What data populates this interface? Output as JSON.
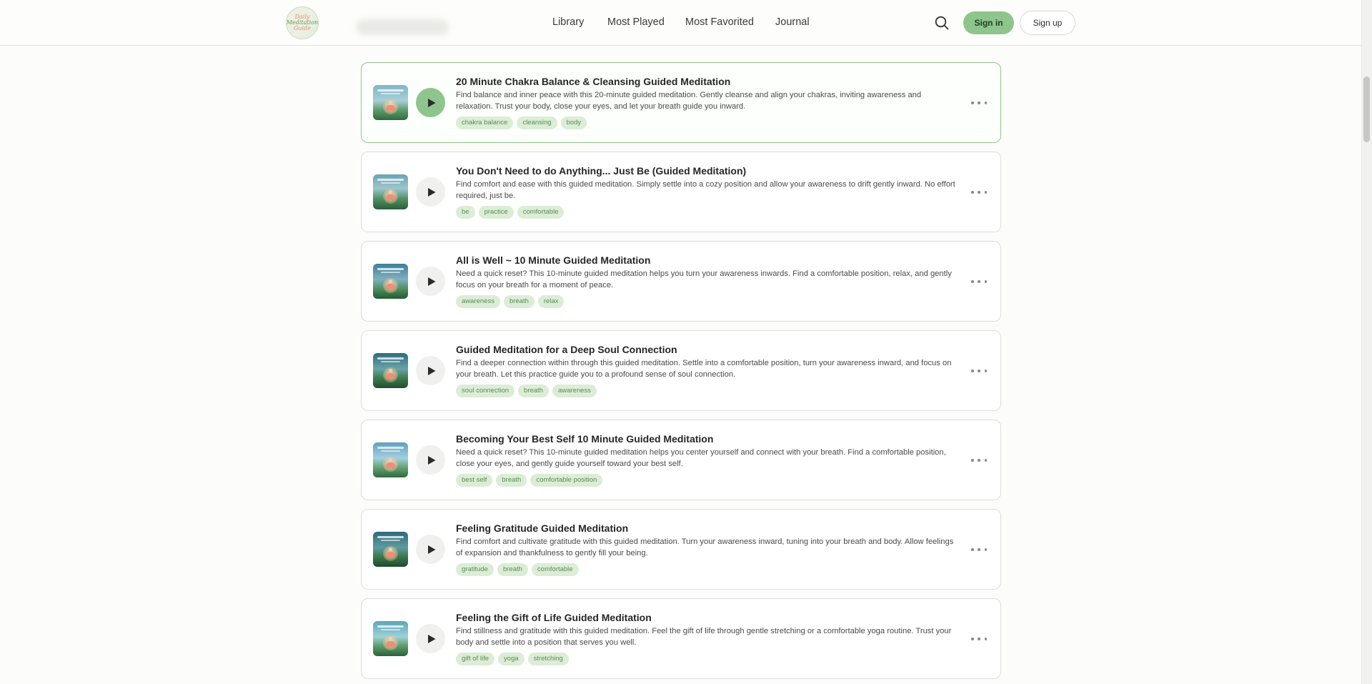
{
  "header": {
    "logo": {
      "line1": "Daily",
      "line2": "Meditation",
      "line3": "Guide"
    },
    "nav": [
      {
        "label": "Library"
      },
      {
        "label": "Most Played"
      },
      {
        "label": "Most Favorited"
      },
      {
        "label": "Journal"
      }
    ],
    "signin_label": "Sign in",
    "signup_label": "Sign up"
  },
  "colors": {
    "accent": "#8ec58c",
    "tag_bg": "#dcedd6",
    "tag_text": "#5a8a57"
  },
  "meditations": [
    {
      "title": "20 Minute Chakra Balance & Cleansing Guided Meditation",
      "description": "Find balance and inner peace with this 20-minute guided meditation. Gently cleanse and align your chakras, inviting awareness and relaxation. Trust your body, close your eyes, and let your breath guide you inward.",
      "tags": [
        "chakra balance",
        "cleansing",
        "body"
      ],
      "playing": true
    },
    {
      "title": "You Don't Need to do Anything... Just Be (Guided Meditation)",
      "description": "Find comfort and ease with this guided meditation. Simply settle into a cozy position and allow your awareness to drift gently inward. No effort required, just be.",
      "tags": [
        "be",
        "practice",
        "comfortable"
      ],
      "playing": false
    },
    {
      "title": "All is Well ~ 10 Minute Guided Meditation",
      "description": "Need a quick reset? This 10-minute guided meditation helps you turn your awareness inwards. Find a comfortable position, relax, and gently focus on your breath for a moment of peace.",
      "tags": [
        "awareness",
        "breath",
        "relax"
      ],
      "playing": false
    },
    {
      "title": "Guided Meditation for a Deep Soul Connection",
      "description": "Find a deeper connection within through this guided meditation. Settle into a comfortable position, turn your awareness inward, and focus on your breath. Let this practice guide you to a profound sense of soul connection.",
      "tags": [
        "soul connection",
        "breath",
        "awareness"
      ],
      "playing": false
    },
    {
      "title": "Becoming Your Best Self 10 Minute Guided Meditation",
      "description": "Need a quick reset? This 10-minute guided meditation helps you center yourself and connect with your breath. Find a comfortable position, close your eyes, and gently guide yourself toward your best self.",
      "tags": [
        "best self",
        "breath",
        "comfortable position"
      ],
      "playing": false
    },
    {
      "title": "Feeling Gratitude Guided Meditation",
      "description": "Find comfort and cultivate gratitude with this guided meditation. Turn your awareness inward, tuning into your breath and body. Allow feelings of expansion and thankfulness to gently fill your being.",
      "tags": [
        "gratitude",
        "breath",
        "comfortable"
      ],
      "playing": false
    },
    {
      "title": "Feeling the Gift of Life Guided Meditation",
      "description": "Find stillness and gratitude with this guided meditation. Feel the gift of life through gentle stretching or a comfortable yoga routine. Trust your body and settle into a position that serves you well.",
      "tags": [
        "gift of life",
        "yoga",
        "stretching"
      ],
      "playing": false
    }
  ]
}
